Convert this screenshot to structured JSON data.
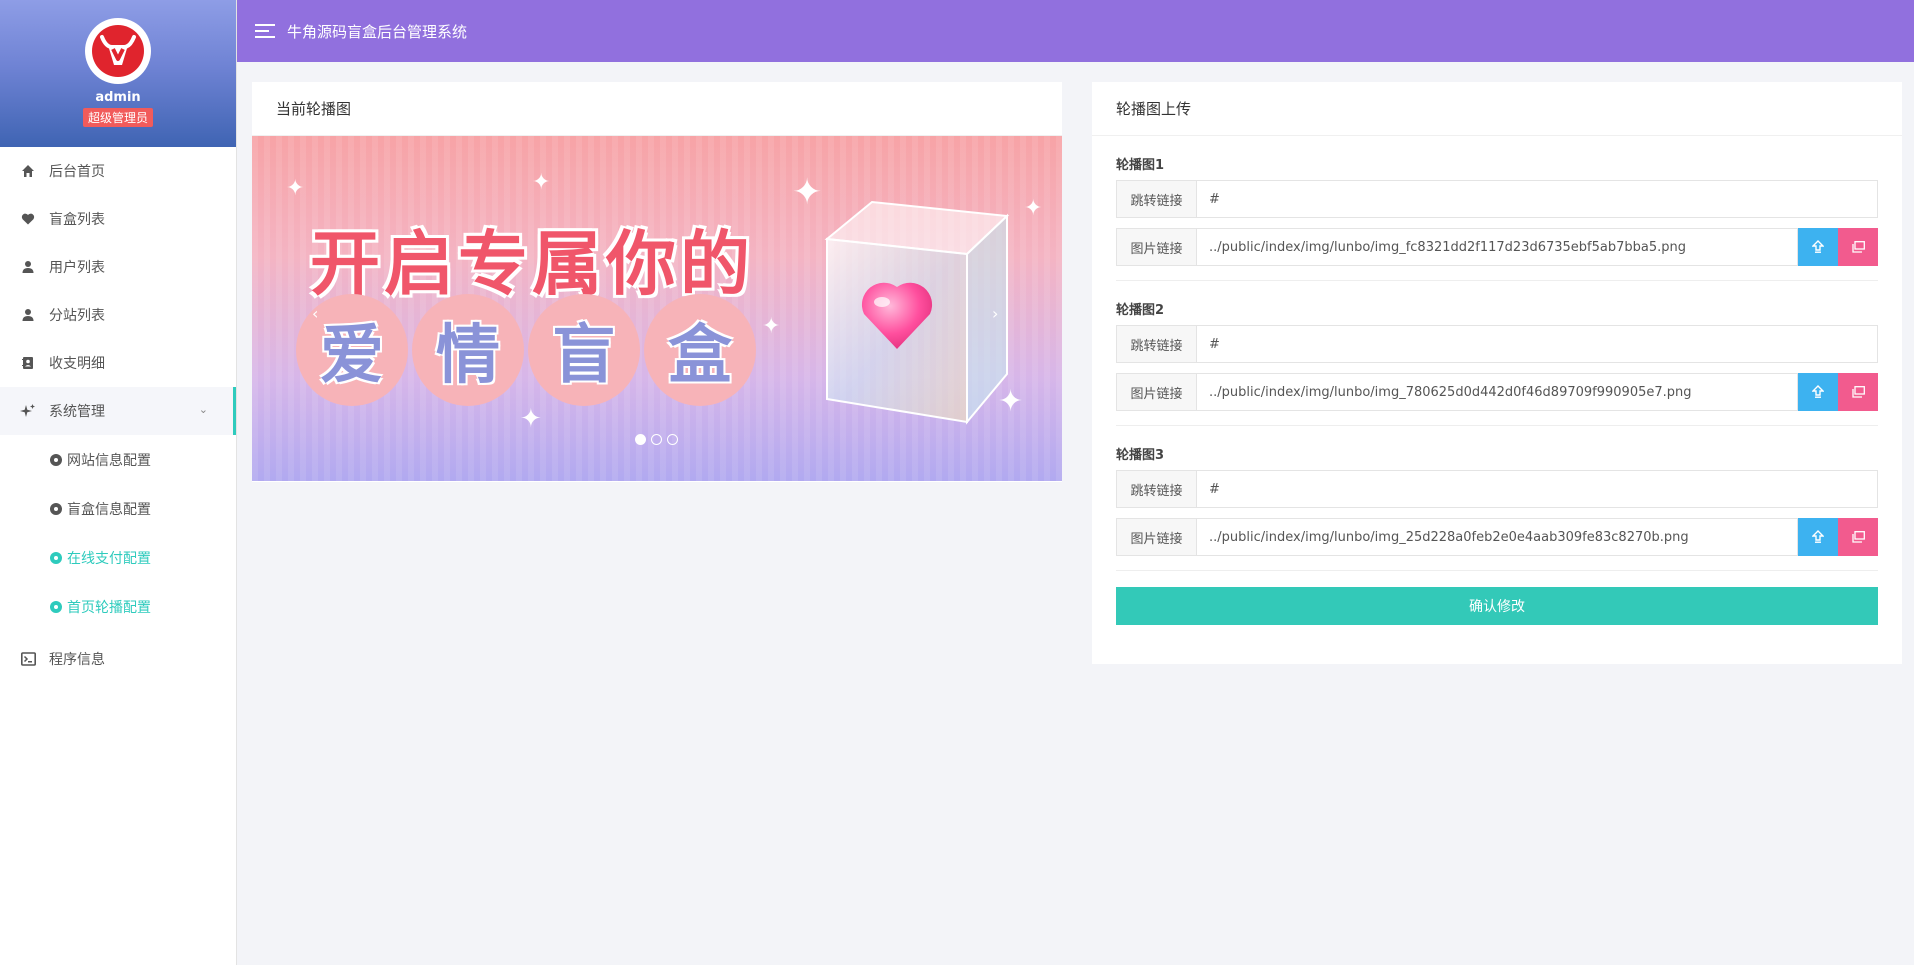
{
  "app": {
    "title": "牛角源码盲盒后台管理系统"
  },
  "profile": {
    "name": "admin",
    "role": "超级管理员"
  },
  "sidebar": {
    "items": [
      {
        "label": "后台首页",
        "icon": "home-icon"
      },
      {
        "label": "盲盒列表",
        "icon": "heart-icon"
      },
      {
        "label": "用户列表",
        "icon": "user-icon"
      },
      {
        "label": "分站列表",
        "icon": "user-icon"
      },
      {
        "label": "收支明细",
        "icon": "contact-book-icon"
      },
      {
        "label": "系统管理",
        "icon": "sparkles-icon",
        "expanded": true
      }
    ],
    "submenu": [
      {
        "label": "网站信息配置",
        "active": false
      },
      {
        "label": "盲盒信息配置",
        "active": false
      },
      {
        "label": "在线支付配置",
        "active": true
      },
      {
        "label": "首页轮播配置",
        "active": true
      }
    ],
    "after": {
      "label": "程序信息",
      "icon": "terminal-icon"
    }
  },
  "left_card": {
    "title": "当前轮播图",
    "banner_line1": "开启专属你的",
    "banner_line2": [
      "爱",
      "情",
      "盲",
      "盒"
    ],
    "prev": "‹",
    "next": "›",
    "slide_count": 3,
    "active_slide": 1
  },
  "right_card": {
    "title": "轮播图上传",
    "link_label": "跳转链接",
    "image_label": "图片链接",
    "groups": [
      {
        "title": "轮播图1",
        "link": "#",
        "image": "../public/index/img/lunbo/img_fc8321dd2f117d23d6735ebf5ab7bba5.png"
      },
      {
        "title": "轮播图2",
        "link": "#",
        "image": "../public/index/img/lunbo/img_780625d0d442d0f46d89709f990905e7.png"
      },
      {
        "title": "轮播图3",
        "link": "#",
        "image": "../public/index/img/lunbo/img_25d228a0feb2e0e4aab309fe83c8270b.png"
      }
    ],
    "submit": "确认修改"
  },
  "colors": {
    "header": "#9170de",
    "accent": "#2ecbbd",
    "upload": "#3db2f0",
    "gallery": "#f25b8e"
  }
}
